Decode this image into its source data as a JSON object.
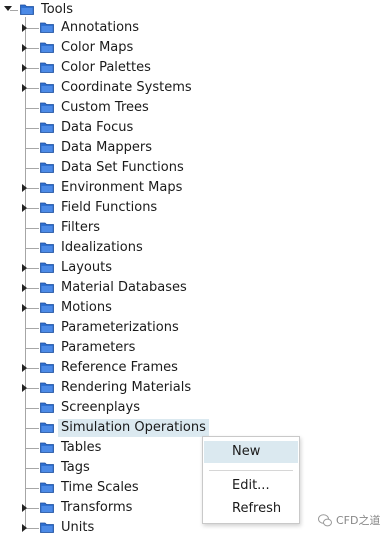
{
  "tree": {
    "root": {
      "label": "Tools",
      "expanded": true
    },
    "children": [
      {
        "label": "Annotations",
        "expandable": true
      },
      {
        "label": "Color Maps",
        "expandable": true
      },
      {
        "label": "Color Palettes",
        "expandable": true
      },
      {
        "label": "Coordinate Systems",
        "expandable": true
      },
      {
        "label": "Custom Trees",
        "expandable": false
      },
      {
        "label": "Data Focus",
        "expandable": false
      },
      {
        "label": "Data Mappers",
        "expandable": false
      },
      {
        "label": "Data Set Functions",
        "expandable": false
      },
      {
        "label": "Environment Maps",
        "expandable": true
      },
      {
        "label": "Field Functions",
        "expandable": true
      },
      {
        "label": "Filters",
        "expandable": false
      },
      {
        "label": "Idealizations",
        "expandable": false
      },
      {
        "label": "Layouts",
        "expandable": true
      },
      {
        "label": "Material Databases",
        "expandable": true
      },
      {
        "label": "Motions",
        "expandable": true
      },
      {
        "label": "Parameterizations",
        "expandable": false
      },
      {
        "label": "Parameters",
        "expandable": false
      },
      {
        "label": "Reference Frames",
        "expandable": true
      },
      {
        "label": "Rendering Materials",
        "expandable": true
      },
      {
        "label": "Screenplays",
        "expandable": false
      },
      {
        "label": "Simulation Operations",
        "expandable": false,
        "selected": true
      },
      {
        "label": "Tables",
        "expandable": false
      },
      {
        "label": "Tags",
        "expandable": false
      },
      {
        "label": "Time Scales",
        "expandable": false
      },
      {
        "label": "Transforms",
        "expandable": true
      },
      {
        "label": "Units",
        "expandable": true
      }
    ]
  },
  "context_menu": {
    "items": [
      "New",
      "Edit...",
      "Refresh"
    ],
    "hovered": "New"
  },
  "watermark": {
    "text": "CFD之道"
  },
  "colors": {
    "folder_fill": "#2f6fd0",
    "selection": "#dbe9f0",
    "tree_line": "#a6a6a6"
  }
}
